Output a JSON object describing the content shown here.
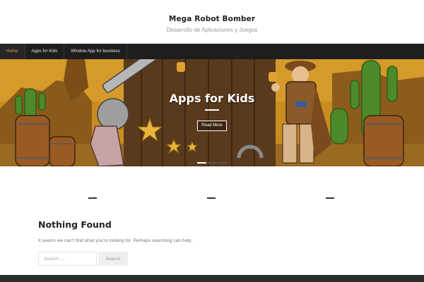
{
  "site": {
    "title": "Mega Robot Bomber",
    "description": "Desarrollo de Aplicaciones y Juegos"
  },
  "nav": {
    "items": [
      {
        "label": "Home",
        "active": true
      },
      {
        "label": "Apps for Kids",
        "active": false
      },
      {
        "label": "Window App for business",
        "active": false
      }
    ]
  },
  "hero": {
    "title": "Apps for Kids",
    "button_label": "Read More",
    "slides_total": 3,
    "active_slide": 1
  },
  "content": {
    "title": "Nothing Found",
    "message": "It seems we can’t find what you’re looking for. Perhaps searching can help.",
    "search_placeholder": "Search …",
    "search_button": "Search"
  },
  "colors": {
    "nav_bg": "#1e1e1e",
    "nav_active": "#f0a84a",
    "footer_bg": "#2c2c2c"
  }
}
